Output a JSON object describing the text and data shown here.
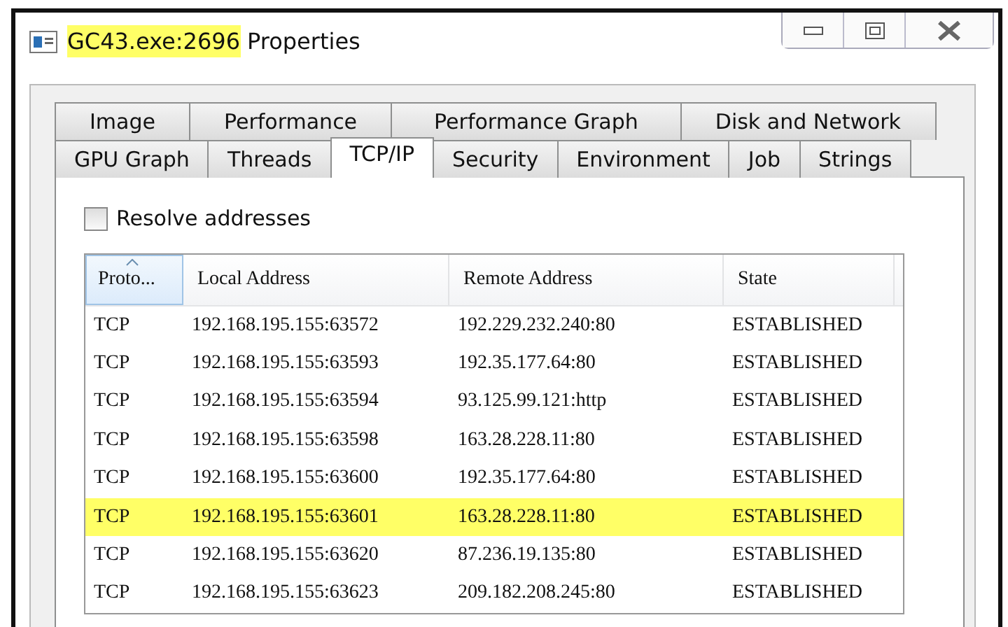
{
  "window": {
    "title_highlighted": "GC43.exe:2696",
    "title_rest": "Properties"
  },
  "tab_rows": [
    [
      {
        "label": "Image",
        "selected": false
      },
      {
        "label": "Performance",
        "selected": false
      },
      {
        "label": "Performance Graph",
        "selected": false
      },
      {
        "label": "Disk and Network",
        "selected": false
      }
    ],
    [
      {
        "label": "GPU Graph",
        "selected": false
      },
      {
        "label": "Threads",
        "selected": false
      },
      {
        "label": "TCP/IP",
        "selected": true
      },
      {
        "label": "Security",
        "selected": false
      },
      {
        "label": "Environment",
        "selected": false
      },
      {
        "label": "Job",
        "selected": false
      },
      {
        "label": "Strings",
        "selected": false
      }
    ]
  ],
  "resolve_addresses": {
    "label": "Resolve addresses",
    "checked": false
  },
  "table": {
    "columns": [
      {
        "label": "Proto...",
        "sorted": true
      },
      {
        "label": "Local Address",
        "sorted": false
      },
      {
        "label": "Remote Address",
        "sorted": false
      },
      {
        "label": "State",
        "sorted": false
      }
    ],
    "rows": [
      {
        "cells": [
          "TCP",
          "192.168.195.155:63572",
          "192.229.232.240:80",
          "ESTABLISHED"
        ],
        "highlighted": false
      },
      {
        "cells": [
          "TCP",
          "192.168.195.155:63593",
          "192.35.177.64:80",
          "ESTABLISHED"
        ],
        "highlighted": false
      },
      {
        "cells": [
          "TCP",
          "192.168.195.155:63594",
          "93.125.99.121:http",
          "ESTABLISHED"
        ],
        "highlighted": false
      },
      {
        "cells": [
          "TCP",
          "192.168.195.155:63598",
          "163.28.228.11:80",
          "ESTABLISHED"
        ],
        "highlighted": false
      },
      {
        "cells": [
          "TCP",
          "192.168.195.155:63600",
          "192.35.177.64:80",
          "ESTABLISHED"
        ],
        "highlighted": false
      },
      {
        "cells": [
          "TCP",
          "192.168.195.155:63601",
          "163.28.228.11:80",
          "ESTABLISHED"
        ],
        "highlighted": true
      },
      {
        "cells": [
          "TCP",
          "192.168.195.155:63620",
          "87.236.19.135:80",
          "ESTABLISHED"
        ],
        "highlighted": false
      },
      {
        "cells": [
          "TCP",
          "192.168.195.155:63623",
          "209.182.208.245:80",
          "ESTABLISHED"
        ],
        "highlighted": false
      }
    ]
  }
}
